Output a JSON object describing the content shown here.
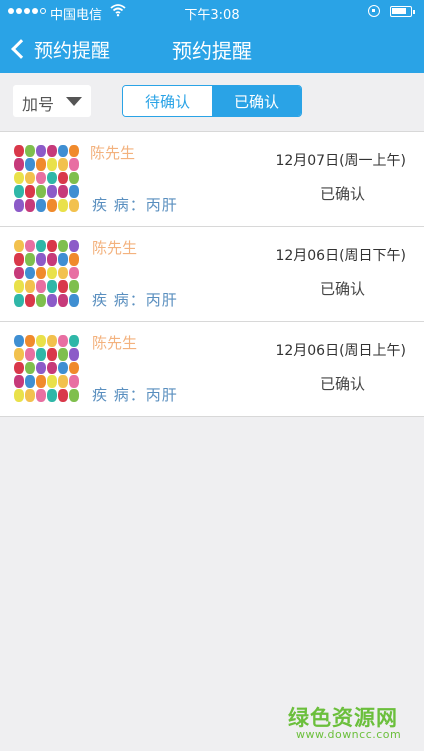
{
  "status_bar": {
    "carrier": "中国电信",
    "time": "下午3:08",
    "icons": [
      "signal-icon",
      "wifi-icon",
      "orientation-lock-icon",
      "battery-icon"
    ]
  },
  "nav": {
    "back_label": "预约提醒",
    "title": "预约提醒"
  },
  "filter": {
    "label": "加号",
    "icon": "dropdown-arrow-icon"
  },
  "tabs": [
    {
      "label": "待确认",
      "active": false
    },
    {
      "label": "已确认",
      "active": true
    }
  ],
  "appointments": [
    {
      "name": "陈先生",
      "disease": "疾  病：丙肝",
      "date": "12月07日(周一上午)",
      "status": "已确认"
    },
    {
      "name": "陈先生",
      "disease": "疾  病：丙肝",
      "date": "12月06日(周日下午)",
      "status": "已确认"
    },
    {
      "name": "陈先生",
      "disease": "疾  病：丙肝",
      "date": "12月06日(周日上午)",
      "status": "已确认"
    }
  ],
  "watermark": {
    "title": "绿色资源网",
    "url": "www.downcc.com"
  },
  "colors": {
    "accent": "#2aa3e6",
    "name": "#f3b27e",
    "disease": "#5a8fbf",
    "background": "#efeff1",
    "watermark": "#6bbf3c"
  }
}
